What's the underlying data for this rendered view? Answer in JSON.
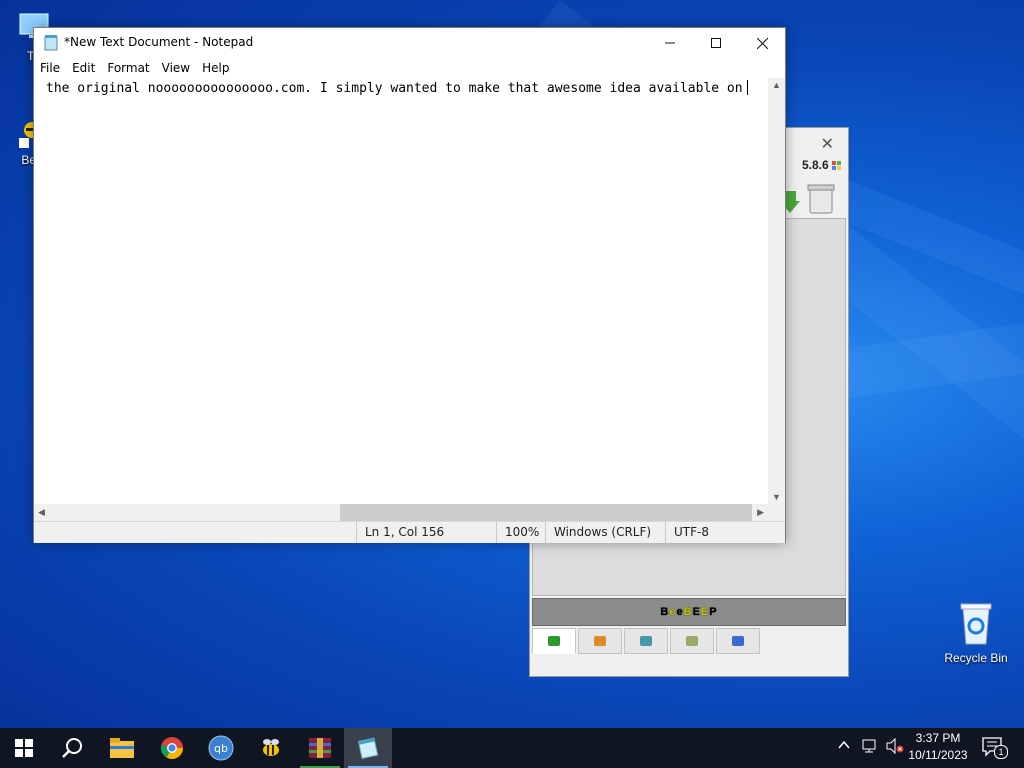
{
  "desktop": {
    "icons": [
      {
        "label": "Th",
        "name": "this-pc"
      },
      {
        "label": "Bee",
        "name": "beebeep-shortcut"
      },
      {
        "label": "Recycle Bin",
        "name": "recycle-bin"
      }
    ]
  },
  "beebeep": {
    "version": "5.8.6",
    "brand": "BeeBEEP",
    "brand_colors": [
      "#000000",
      "#c8c800",
      "#000000",
      "#c8c800",
      "#000000",
      "#c8c800",
      "#000000"
    ]
  },
  "notepad": {
    "title": "*New Text Document - Notepad",
    "menu": [
      "File",
      "Edit",
      "Format",
      "View",
      "Help"
    ],
    "content": "the original nooooooooooooooo.com. I simply wanted to make that awesome idea available on",
    "status": {
      "position": "Ln 1, Col 156",
      "zoom": "100%",
      "line_ending": "Windows (CRLF)",
      "encoding": "UTF-8"
    }
  },
  "taskbar": {
    "apps": [
      "start",
      "search",
      "file-explorer",
      "chrome",
      "qbittorrent",
      "beebeep",
      "winrar",
      "notepad"
    ],
    "active": "notepad",
    "time": "3:37 PM",
    "date": "10/11/2023",
    "notifications": "1"
  },
  "colors": {
    "accent": "#0a57d0",
    "taskbar": "#101522"
  }
}
